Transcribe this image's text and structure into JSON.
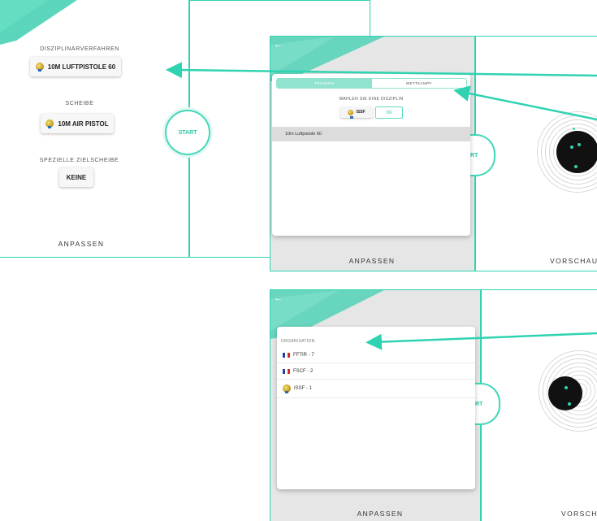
{
  "panel_left": {
    "discipline_procedure_label": "DISZIPLINARVERFAHREN",
    "discipline_button_label": "10M LUFTPISTOLE 60",
    "target_label": "SCHEIBE",
    "target_button_label": "10M AIR PISTOL",
    "special_target_label": "SPEZIELLE ZIELSCHEIBE",
    "special_target_button_label": "KEINE",
    "start_label": "START",
    "footer_label": "ANPASSEN"
  },
  "panel_mid": {
    "back_icon": "arrow-left-icon",
    "tabs": [
      {
        "label": "TRAINING",
        "active": true
      },
      {
        "label": "WETTKAMPF",
        "active": false
      }
    ],
    "choose_label": "WAHLEN SIE EINE DISZIPLIN",
    "org_button_label": "ISSF",
    "ok_label": "OK",
    "list_items": [
      "10m Luftpistole 60"
    ],
    "start_label": "ART",
    "footer_left": "ANPASSEN",
    "footer_right": "VORSCHAU"
  },
  "panel_bottom": {
    "back_icon": "arrow-left-icon",
    "section_title": "ORGANISATION",
    "organisations": [
      {
        "label": "FFTIR - 7",
        "icon": "france-flag-icon"
      },
      {
        "label": "FSCF - 2",
        "icon": "france-flag-icon"
      },
      {
        "label": "ISSF - 1",
        "icon": "medal-icon"
      }
    ],
    "start_label": "ART",
    "footer_left": "ANPASSEN",
    "footer_right": "VORSCH"
  },
  "colors": {
    "accent": "#2fd3b1",
    "accent_light": "#8fe3cf",
    "overlay": "#e6e6e6"
  }
}
